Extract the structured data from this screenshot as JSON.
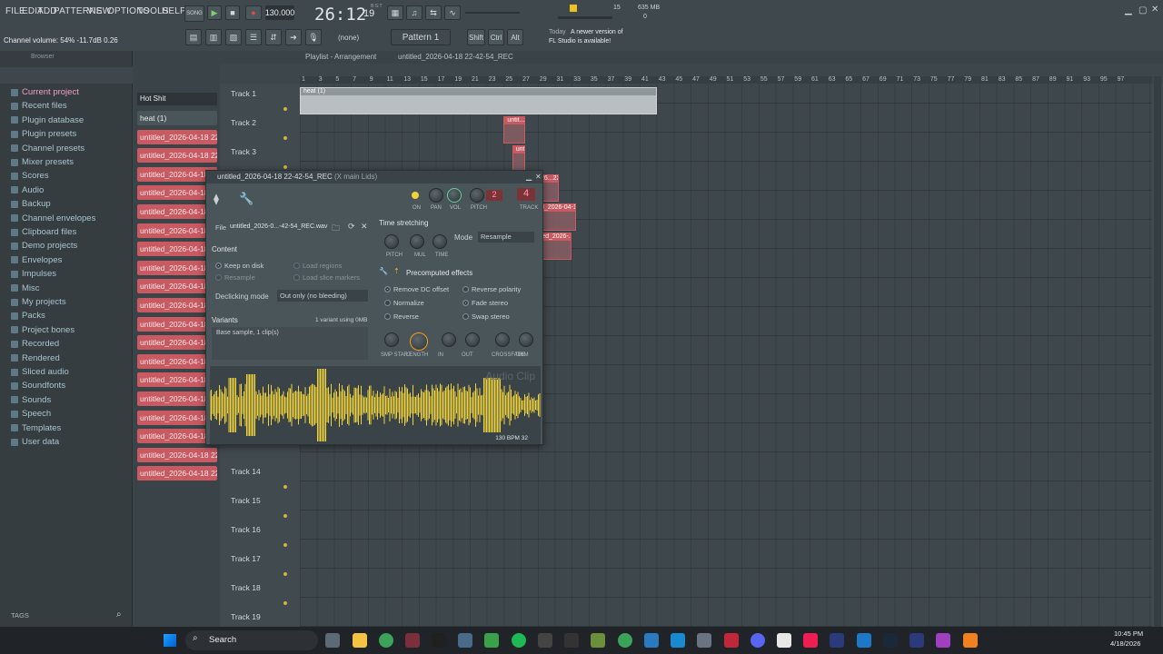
{
  "menu": [
    "FILE",
    "EDIT",
    "ADD",
    "PATTERNS",
    "VIEW",
    "OPTIONS",
    "TOOLS",
    "HELP"
  ],
  "transport": {
    "mode": "SONG",
    "tempo": "130.000",
    "time": "26:12",
    "time_ticks": "19",
    "time_unit": "B:S:T",
    "cpu": "15",
    "memory": "635 MB",
    "polyphony": "0"
  },
  "hint": {
    "text": "Channel volume: 54%  -11.7dB  0.26"
  },
  "toolbar": {
    "snap": "(none)",
    "pattern": "Pattern 1",
    "shift": "Shift",
    "ctrl": "Ctrl",
    "alt": "Alt",
    "news_day": "Today",
    "news_text": "A newer version of",
    "news_text2": "FL Studio is available!"
  },
  "browser": {
    "title": "Browser",
    "tags": "TAGS",
    "items": [
      "Current project",
      "Recent files",
      "Plugin database",
      "Plugin presets",
      "Channel presets",
      "Mixer presets",
      "Scores",
      "Audio",
      "Backup",
      "Channel envelopes",
      "Clipboard files",
      "Demo projects",
      "Envelopes",
      "Impulses",
      "Misc",
      "My projects",
      "Packs",
      "Project bones",
      "Recorded",
      "Rendered",
      "Sliced audio",
      "Soundfonts",
      "Sounds",
      "Speech",
      "Templates",
      "User data"
    ]
  },
  "channel_rack": {
    "filter": "Hot Shit",
    "channels": [
      "heat (1)",
      "untitled_2026-04-18 22-...",
      "untitled_2026-04-18 22-...",
      "untitled_2026-04-18",
      "untitled_2026-04-18",
      "untitled_2026-04-18",
      "untitled_2026-04-18",
      "untitled_2026-04-18",
      "untitled_2026-04-18",
      "untitled_2026-04-18",
      "untitled_2026-04-18",
      "untitled_2026-04-18",
      "untitled_2026-04-18",
      "untitled_2026-04-18",
      "untitled_2026-04-18",
      "untitled_2026-04-18",
      "untitled_2026-04-18",
      "untitled_2026-04-18 22-...",
      "untitled_2026-04-18 22-...",
      "untitled_2026-04-18 22-..."
    ]
  },
  "playlist": {
    "title": "Playlist - Arrangement",
    "pattern_name": "untitled_2026-04-18 22-42-54_REC",
    "ruler": [
      "1",
      "3",
      "5",
      "7",
      "9",
      "11",
      "13",
      "15",
      "17",
      "19",
      "21",
      "23",
      "25",
      "27",
      "29",
      "31",
      "33",
      "35",
      "37",
      "39",
      "41",
      "43",
      "45",
      "47",
      "49",
      "51",
      "53",
      "55",
      "57",
      "59",
      "61",
      "63",
      "65",
      "67",
      "69",
      "71",
      "73",
      "75",
      "77",
      "79",
      "81",
      "83",
      "85",
      "87",
      "89",
      "91",
      "93",
      "95",
      "97"
    ],
    "tracks": [
      {
        "name": "Track 1",
        "row": 0
      },
      {
        "name": "Track 2",
        "row": 1
      },
      {
        "name": "Track 3",
        "row": 2
      },
      {
        "name": "Track 14",
        "row": 13
      },
      {
        "name": "Track 15",
        "row": 14
      },
      {
        "name": "Track 16",
        "row": 15
      },
      {
        "name": "Track 17",
        "row": 16
      },
      {
        "name": "Track 18",
        "row": 17
      },
      {
        "name": "Track 19",
        "row": 18
      }
    ],
    "clips": [
      {
        "label": "heat (1)",
        "start": 1,
        "bars": 42,
        "row": 0,
        "color": "gray"
      },
      {
        "label": "untit..._REC",
        "start": 25,
        "bars": 2.5,
        "row": 1,
        "color": "red"
      },
      {
        "label": "unti..._REC",
        "start": 26,
        "bars": 1.5,
        "row": 2,
        "color": "red"
      },
      {
        "label": "026...22-30-55_REC",
        "start": 28.5,
        "bars": 3,
        "row": 3,
        "color": "red"
      },
      {
        "label": "ed_2026-04-18 22-42-54_REC",
        "start": 28.5,
        "bars": 5,
        "row": 4,
        "color": "red"
      },
      {
        "label": "itled_2026-...22-45-03_REC",
        "start": 28.5,
        "bars": 4.5,
        "row": 5,
        "color": "red"
      }
    ]
  },
  "sampler": {
    "title": "untitled_2026-04-18 22-42-54_REC",
    "subtitle": "(X main Lids)",
    "file_label": "File",
    "file_name": "untitled_2026-0...-42-54_REC.wav",
    "knob_labels": [
      "ON",
      "PAN",
      "VOL",
      "PITCH",
      "TRACK"
    ],
    "pitch_value": "2",
    "track_value": "4",
    "content": "Content",
    "keep_on_disk": "Keep on disk",
    "resample": "Resample",
    "load_regions": "Load regions",
    "load_slice": "Load slice markers",
    "declick_label": "Declicking mode",
    "declick_value": "Out only (no bleeding)",
    "variants": "Variants",
    "variants_info": "1 variant using 0MB",
    "variant_item": "Base sample, 1 clip(s)",
    "time_stretching": "Time stretching",
    "ts_knobs": [
      "PITCH",
      "MUL",
      "TIME"
    ],
    "mode_label": "Mode",
    "mode_value": "Resample",
    "precomputed": "Precomputed effects",
    "effects_left": [
      {
        "label": "Remove DC offset",
        "on": true
      },
      {
        "label": "Normalize",
        "on": false
      },
      {
        "label": "Reverse",
        "on": false
      }
    ],
    "effects_right": [
      {
        "label": "Reverse polarity",
        "on": false
      },
      {
        "label": "Fade stereo",
        "on": true
      },
      {
        "label": "Swap stereo",
        "on": false
      }
    ],
    "fx_knobs": [
      "SMP START",
      "LENGTH",
      "IN",
      "OUT",
      "CROSSFADE",
      "TRIM"
    ],
    "watermark": "Audio Clip",
    "bpm_info": "130 BPM 32"
  },
  "taskbar": {
    "search": "Search",
    "time": "10:45 PM",
    "date": "4/18/2026"
  },
  "colors": {
    "accent": "#c95a62",
    "wave": "#f0d23a",
    "bg": "#3b4448"
  }
}
